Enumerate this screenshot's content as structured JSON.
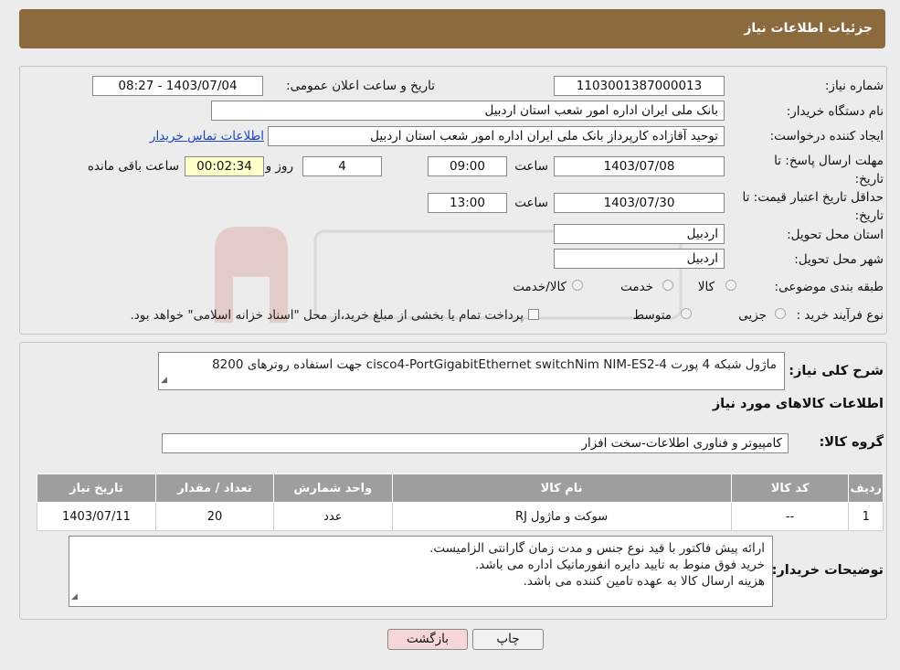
{
  "header": {
    "title": "جزئیات اطلاعات نیاز"
  },
  "form": {
    "need_number_label": "شماره نیاز:",
    "need_number": "1103001387000013",
    "announce_label": "تاریخ و ساعت اعلان عمومی:",
    "announce_value": "1403/07/04 - 08:27",
    "buyer_label": "نام دستگاه خریدار:",
    "buyer_value": "بانک ملی ایران اداره امور شعب استان اردبیل",
    "creator_label": "ایجاد کننده درخواست:",
    "creator_value": "توحید آقازاده کارپرداز بانک ملی ایران اداره امور شعب استان اردبیل",
    "contact_link": "اطلاعات تماس خریدار",
    "reply_deadline_label": "مهلت ارسال پاسخ: تا تاریخ:",
    "reply_date": "1403/07/08",
    "time_label": "ساعت",
    "reply_time": "09:00",
    "days_value": "4",
    "days_label": "روز و",
    "remaining_time": "00:02:34",
    "remaining_label": "ساعت باقی مانده",
    "validity_label": "حداقل تاریخ اعتبار قیمت: تا تاریخ:",
    "validity_date": "1403/07/30",
    "validity_time": "13:00",
    "province_label": "استان محل تحویل:",
    "province_value": "اردبیل",
    "city_label": "شهر محل تحویل:",
    "city_value": "اردبیل",
    "category_label": "طبقه بندی موضوعی:",
    "category_options": [
      "کالا",
      "خدمت",
      "کالا/خدمت"
    ],
    "process_label": "نوع فرآیند خرید :",
    "process_options": [
      "جزیی",
      "متوسط"
    ],
    "process_note": "پرداخت تمام یا بخشی از مبلغ خرید،از محل \"اسناد خزانه اسلامی\" خواهد بود."
  },
  "details": {
    "summary_label": "شرح کلی نیاز:",
    "summary_value": "ماژول شبکه 4 پورت    cisco4-PortGigabitEthernet switchNim NIM-ES2-4  جهت استفاده روترهای 8200",
    "goods_info_title": "اطلاعات کالاهای مورد نیاز",
    "goods_group_label": "گروه کالا:",
    "goods_group_value": "کامپیوتر و فناوری اطلاعات-سخت افزار",
    "table": {
      "headers": [
        "ردیف",
        "کد کالا",
        "نام کالا",
        "واحد شمارش",
        "تعداد / مقدار",
        "تاریخ نیاز"
      ],
      "rows": [
        [
          "1",
          "--",
          "سوکت و ماژول RJ",
          "عدد",
          "20",
          "1403/07/11"
        ]
      ]
    },
    "buyer_notes_label": "توضیحات خریدار:",
    "buyer_notes": [
      "ارائه پیش فاکتور با قید نوع جنس و مدت زمان گارانتی الزامیست.",
      "خرید فوق منوط به تایید دایره انفورماتیک اداره می باشد.",
      "هزینه ارسال کالا به عهده تامین کننده می باشد."
    ]
  },
  "buttons": {
    "print": "چاپ",
    "back": "بازگشت"
  },
  "colors": {
    "header": "#8b6a3d",
    "table_header": "#9e9e9e",
    "back_button": "#f6d6d6",
    "print_button": "#f2f2f2"
  }
}
